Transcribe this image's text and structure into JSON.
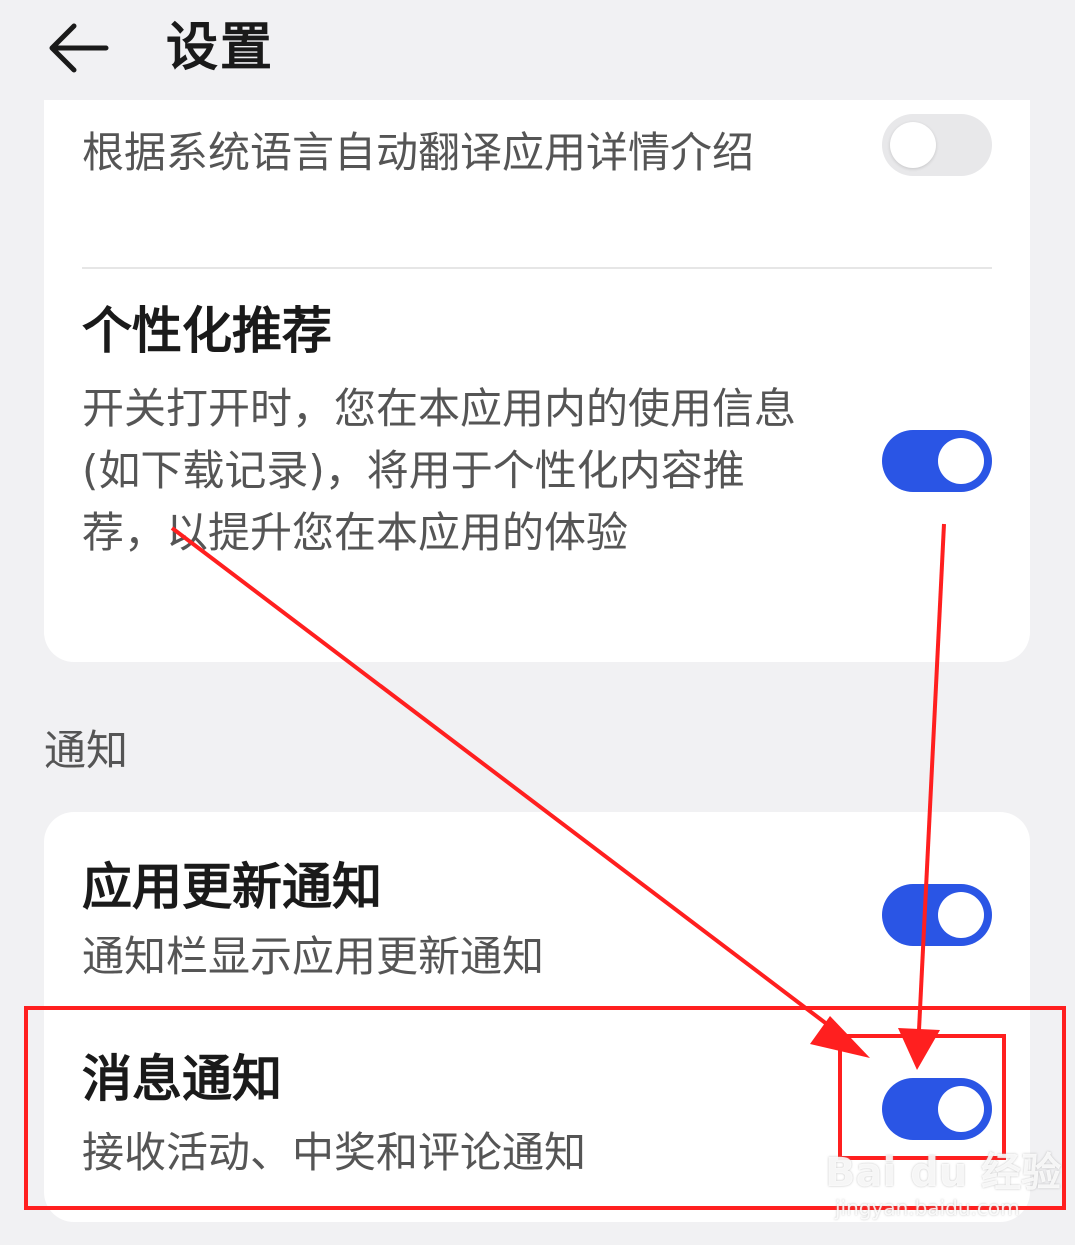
{
  "header": {
    "title": "设置",
    "back_icon": "arrow-left-icon"
  },
  "colors": {
    "accent": "#2a55e5",
    "annotation": "#ff1f1f",
    "background": "#f1f1f3"
  },
  "settings": {
    "translate": {
      "desc": "根据系统语言自动翻译应用详情介绍",
      "enabled": false
    },
    "personalized": {
      "title": "个性化推荐",
      "desc": "开关打开时，您在本应用内的使用信息 (如下载记录)，将用于个性化内容推荐，以提升您在本应用的体验",
      "enabled": true
    }
  },
  "notifications": {
    "section_label": "通知",
    "app_update": {
      "title": "应用更新通知",
      "desc": "通知栏显示应用更新通知",
      "enabled": true
    },
    "message": {
      "title": "消息通知",
      "desc": "接收活动、中奖和评论通知",
      "enabled": true
    }
  },
  "watermark": {
    "brand": "Bai du 经验",
    "url": "jingyan.baidu.com"
  }
}
